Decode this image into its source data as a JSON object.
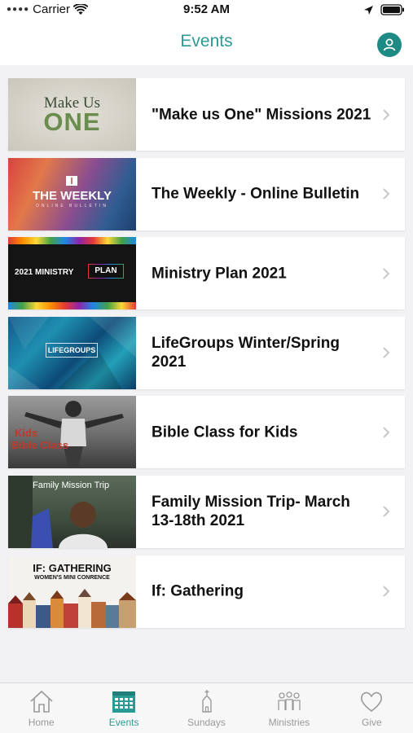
{
  "status_bar": {
    "carrier": "Carrier",
    "time": "9:52 AM"
  },
  "nav": {
    "title": "Events"
  },
  "events": [
    {
      "title": "\"Make us One\" Missions 2021",
      "thumb_lines": [
        "Make Us",
        "ONE"
      ]
    },
    {
      "title": "The Weekly - Online Bulletin",
      "thumb_lines": [
        "THE WEEKLY",
        "ONLINE BULLETIN"
      ]
    },
    {
      "title": "Ministry Plan 2021",
      "thumb_lines": [
        "2021 MINISTRY",
        "PLAN"
      ]
    },
    {
      "title": "LifeGroups Winter/Spring 2021",
      "thumb_lines": [
        "LIFEGROUPS"
      ]
    },
    {
      "title": "Bible Class for Kids",
      "thumb_lines": [
        "Kids",
        "Bible Class"
      ]
    },
    {
      "title": "Family Mission Trip- March 13-18th 2021",
      "thumb_lines": [
        "Family Mission Trip"
      ]
    },
    {
      "title": "If: Gathering",
      "thumb_lines": [
        "IF: GATHERING",
        "WOMEN'S MINI CONRENCE"
      ]
    }
  ],
  "tabs": [
    {
      "label": "Home",
      "icon": "home-icon",
      "active": false
    },
    {
      "label": "Events",
      "icon": "calendar-icon",
      "active": true
    },
    {
      "label": "Sundays",
      "icon": "church-icon",
      "active": false
    },
    {
      "label": "Ministries",
      "icon": "people-icon",
      "active": false
    },
    {
      "label": "Give",
      "icon": "heart-icon",
      "active": false
    }
  ],
  "colors": {
    "accent": "#2a9b94",
    "inactive": "#9a9a9a"
  }
}
